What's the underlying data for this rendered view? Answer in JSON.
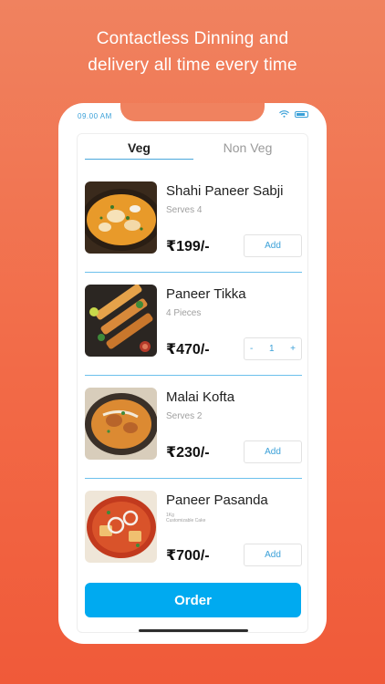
{
  "headline": {
    "line1": "Contactless Dinning and",
    "line2": "delivery all time every time"
  },
  "status_bar": {
    "time": "09.00 AM",
    "wifi_icon": "wifi-icon",
    "battery_icon": "battery-icon"
  },
  "tabs": [
    {
      "label": "Veg",
      "active": true
    },
    {
      "label": "Non Veg",
      "active": false
    }
  ],
  "items": [
    {
      "name": "Shahi Paneer Sabji",
      "sub": "Serves 4",
      "price": "₹199/-",
      "action": "Add"
    },
    {
      "name": "Paneer Tikka",
      "sub": "4 Pieces",
      "price": "₹470/-",
      "stepper": {
        "minus": "-",
        "qty": "1",
        "plus": "+"
      }
    },
    {
      "name": "Malai Kofta",
      "sub": "Serves 2",
      "price": "₹230/-",
      "action": "Add"
    },
    {
      "name": "Paneer Pasanda",
      "sub_line1": "1Kg",
      "sub_line2": "Customizable Cake",
      "price": "₹700/-",
      "action": "Add"
    }
  ],
  "order_button": "Order",
  "colors": {
    "accent": "#00aaf0",
    "background_top": "#f0825f",
    "background_bottom": "#f05a39",
    "link": "#3aa0d8"
  }
}
